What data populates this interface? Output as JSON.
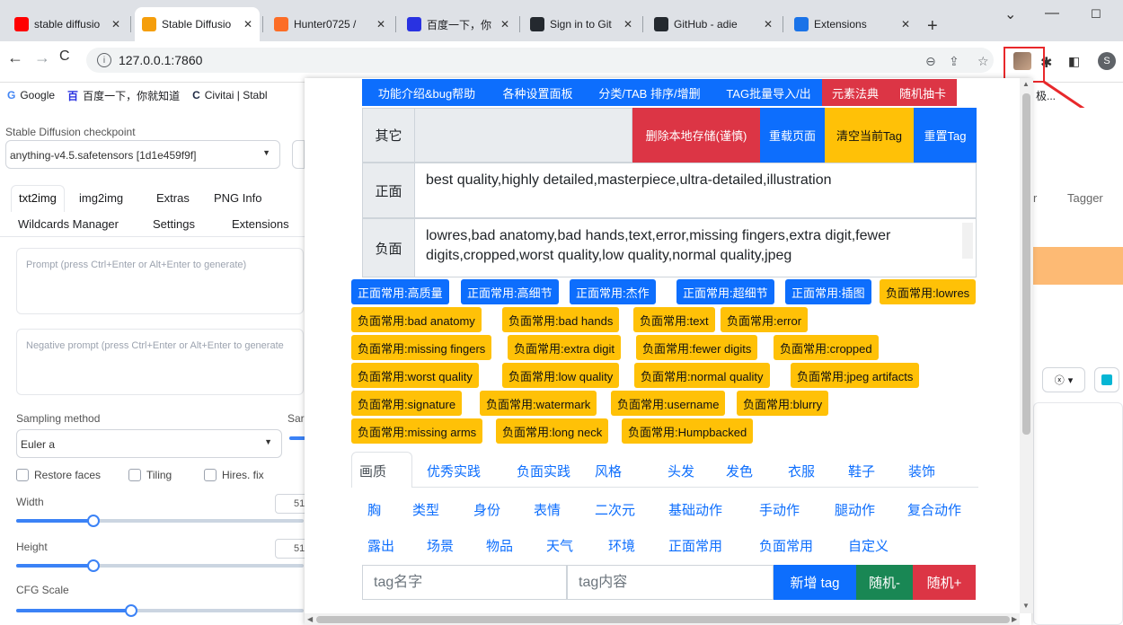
{
  "browser": {
    "tabs": [
      {
        "title": "stable diffusio",
        "icon": "youtube-icon",
        "color": "#ff0000"
      },
      {
        "title": "Stable Diffusio",
        "icon": "stable-diffusion-icon",
        "color": "#f59e0b"
      },
      {
        "title": "Hunter0725 /",
        "icon": "gitlab-icon",
        "color": "#fc6d26"
      },
      {
        "title": "百度一下，你",
        "icon": "baidu-icon",
        "color": "#2932e1"
      },
      {
        "title": "Sign in to Git",
        "icon": "github-icon",
        "color": "#24292f"
      },
      {
        "title": "GitHub - adie",
        "icon": "github-icon",
        "color": "#24292f"
      },
      {
        "title": "Extensions",
        "icon": "puzzle-icon",
        "color": "#1a73e8"
      }
    ],
    "url": "127.0.0.1:7860",
    "bookmarks": [
      {
        "label": "Google",
        "icon": "G"
      },
      {
        "label": "百度一下，你就知道",
        "icon": "百"
      },
      {
        "label": "Civitai | Stabl",
        "icon": "C"
      }
    ],
    "bookmark_overflow": "极..."
  },
  "sd": {
    "checkpoint_label": "Stable Diffusion checkpoint",
    "checkpoint_value": "anything-v4.5.safetensors [1d1e459f9f]",
    "tabs_row1": [
      "txt2img",
      "img2img",
      "Extras",
      "PNG Info"
    ],
    "tabs_row2": [
      "Wildcards Manager",
      "Settings",
      "Extensions"
    ],
    "right_tab_partial": "r",
    "right_tab": "Tagger",
    "prompt_placeholder": "Prompt (press Ctrl+Enter or Alt+Enter to generate)",
    "negative_placeholder": "Negative prompt (press Ctrl+Enter or Alt+Enter to generate",
    "sampling_label": "Sampling method",
    "sampling_value": "Euler a",
    "sampling_steps_partial": "Sar",
    "restore_faces": "Restore faces",
    "tiling": "Tiling",
    "hires_fix": "Hires. fix",
    "width_label": "Width",
    "width_value": "51",
    "height_label": "Height",
    "height_value": "51",
    "cfg_label": "CFG Scale"
  },
  "panel": {
    "top_buttons": [
      {
        "label": "功能介绍&bug帮助",
        "style": "blue"
      },
      {
        "label": "各种设置面板",
        "style": "blue"
      },
      {
        "label": "分类/TAB 排序/增删",
        "style": "blue"
      },
      {
        "label": "TAG批量导入/出",
        "style": "blue"
      },
      {
        "label": "元素法典",
        "style": "red"
      },
      {
        "label": "随机抽卡",
        "style": "red"
      }
    ],
    "other_label": "其它",
    "action_buttons": [
      {
        "label": "删除本地存储(谨慎)",
        "style": "red"
      },
      {
        "label": "重载页面",
        "style": "blue"
      },
      {
        "label": "清空当前Tag",
        "style": "yellow"
      },
      {
        "label": "重置Tag",
        "style": "blue"
      }
    ],
    "positive_label": "正面",
    "positive_text": "best quality,highly detailed,masterpiece,ultra-detailed,illustration",
    "negative_label": "负面",
    "negative_text": "lowres,bad anatomy,bad hands,text,error,missing fingers,extra digit,fewer digits,cropped,worst quality,low quality,normal quality,jpeg",
    "chips": [
      {
        "label": "正面常用:高质量",
        "style": "b"
      },
      {
        "label": "正面常用:高细节",
        "style": "b"
      },
      {
        "label": "正面常用:杰作",
        "style": "b"
      },
      {
        "label": "正面常用:超细节",
        "style": "b"
      },
      {
        "label": "正面常用:插图",
        "style": "b"
      },
      {
        "label": "负面常用:lowres",
        "style": "y"
      },
      {
        "label": "负面常用:bad anatomy",
        "style": "y"
      },
      {
        "label": "负面常用:bad hands",
        "style": "y"
      },
      {
        "label": "负面常用:text",
        "style": "y"
      },
      {
        "label": "负面常用:error",
        "style": "y"
      },
      {
        "label": "负面常用:missing fingers",
        "style": "y"
      },
      {
        "label": "负面常用:extra digit",
        "style": "y"
      },
      {
        "label": "负面常用:fewer digits",
        "style": "y"
      },
      {
        "label": "负面常用:cropped",
        "style": "y"
      },
      {
        "label": "负面常用:worst quality",
        "style": "y"
      },
      {
        "label": "负面常用:low quality",
        "style": "y"
      },
      {
        "label": "负面常用:normal quality",
        "style": "y"
      },
      {
        "label": "负面常用:jpeg artifacts",
        "style": "y"
      },
      {
        "label": "负面常用:signature",
        "style": "y"
      },
      {
        "label": "负面常用:watermark",
        "style": "y"
      },
      {
        "label": "负面常用:username",
        "style": "y"
      },
      {
        "label": "负面常用:blurry",
        "style": "y"
      },
      {
        "label": "负面常用:missing arms",
        "style": "y"
      },
      {
        "label": "负面常用:long neck",
        "style": "y"
      },
      {
        "label": "负面常用:Humpbacked",
        "style": "y"
      }
    ],
    "categories": [
      [
        "画质",
        "优秀实践",
        "负面实践",
        "风格",
        "头发",
        "发色",
        "衣服",
        "鞋子",
        "装饰"
      ],
      [
        "胸",
        "类型",
        "身份",
        "表情",
        "二次元",
        "基础动作",
        "手动作",
        "腿动作",
        "复合动作"
      ],
      [
        "露出",
        "场景",
        "物品",
        "天气",
        "环境",
        "正面常用",
        "负面常用",
        "自定义"
      ]
    ],
    "tag_name_placeholder": "tag名字",
    "tag_content_placeholder": "tag内容",
    "add_tag": "新增 tag",
    "random_minus": "随机-",
    "random_plus": "随机+"
  }
}
